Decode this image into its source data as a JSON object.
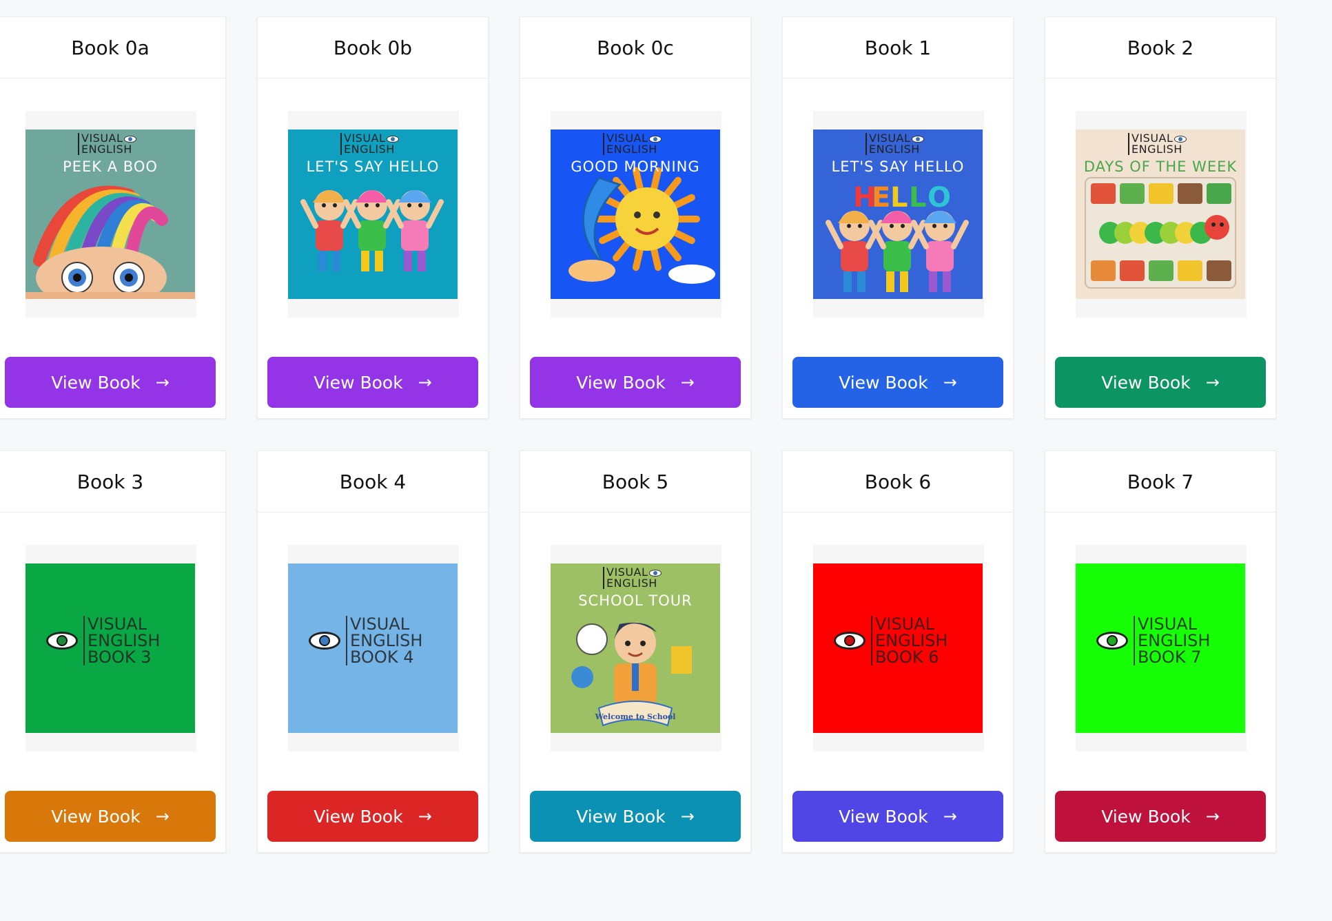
{
  "books": [
    {
      "title": "Book 0a",
      "button_label": "View Book",
      "button_color": "#9334e6",
      "cover": {
        "type": "art",
        "bg": "#6fa79c",
        "brand_line1": "VISUAL",
        "brand_line2": "ENGLISH",
        "title": "PEEK A BOO",
        "title_color": "#ffffff",
        "art": "boy-peeking"
      }
    },
    {
      "title": "Book 0b",
      "button_label": "View Book",
      "button_color": "#9334e6",
      "cover": {
        "type": "art",
        "bg": "#0fa0c0",
        "brand_line1": "VISUAL",
        "brand_line2": "ENGLISH",
        "title": "LET'S SAY HELLO",
        "title_color": "#ffffff",
        "art": "three-kids-waving"
      }
    },
    {
      "title": "Book 0c",
      "button_label": "View Book",
      "button_color": "#9334e6",
      "cover": {
        "type": "art",
        "bg": "#1755f5",
        "brand_line1": "VISUAL",
        "brand_line2": "ENGLISH",
        "title": "GOOD MORNING",
        "title_color": "#ffffff",
        "art": "sun-and-moon"
      }
    },
    {
      "title": "Book 1",
      "button_label": "View Book",
      "button_color": "#2463e6",
      "cover": {
        "type": "art",
        "bg": "#3563d8",
        "brand_line1": "VISUAL",
        "brand_line2": "ENGLISH",
        "title": "LET'S SAY HELLO",
        "title_color": "#ffffff",
        "art": "hello-kids"
      }
    },
    {
      "title": "Book 2",
      "button_label": "View Book",
      "button_color": "#0c9462",
      "cover": {
        "type": "art",
        "bg": "#f2e2d2",
        "brand_line1": "VISUAL",
        "brand_line2": "ENGLISH",
        "title": "DAYS OF THE WEEK",
        "title_color": "#4aa64a",
        "art": "caterpillar-food"
      }
    },
    {
      "title": "Book 3",
      "button_label": "View Book",
      "button_color": "#d8780a",
      "cover": {
        "type": "logo",
        "bg": "#0aa844",
        "line1": "VISUAL",
        "line2": "ENGLISH",
        "line3": "BOOK 3",
        "iris": "#1d8a3c"
      }
    },
    {
      "title": "Book 4",
      "button_label": "View Book",
      "button_color": "#dc2626",
      "cover": {
        "type": "logo",
        "bg": "#74b4e6",
        "line1": "VISUAL",
        "line2": "ENGLISH",
        "line3": "BOOK 4",
        "iris": "#3a7dc0"
      }
    },
    {
      "title": "Book 5",
      "button_label": "View Book",
      "button_color": "#0b91b3",
      "cover": {
        "type": "art",
        "bg": "#9cc063",
        "brand_line1": "VISUAL",
        "brand_line2": "ENGLISH",
        "title": "SCHOOL TOUR",
        "title_color": "#ffffff",
        "art": "school-boy",
        "banner": "Welcome to School"
      }
    },
    {
      "title": "Book 6",
      "button_label": "View Book",
      "button_color": "#4f46e5",
      "cover": {
        "type": "logo",
        "bg": "#ff0000",
        "line1": "VISUAL",
        "line2": "ENGLISH",
        "line3": "BOOK 6",
        "iris": "#c81010"
      }
    },
    {
      "title": "Book 7",
      "button_label": "View Book",
      "button_color": "#be123c",
      "cover": {
        "type": "logo",
        "bg": "#16ff06",
        "line1": "VISUAL",
        "line2": "ENGLISH",
        "line3": "BOOK 7",
        "iris": "#22aa22"
      }
    }
  ],
  "arrow_glyph": "→"
}
